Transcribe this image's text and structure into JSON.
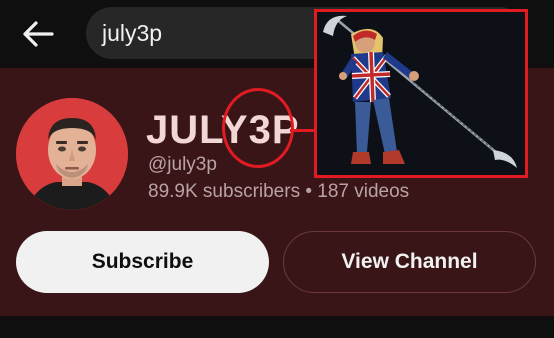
{
  "search": {
    "query": "july3p"
  },
  "channel": {
    "name": "JULY3P",
    "handle": "@july3p",
    "stats": "89.9K subscribers • 187 videos"
  },
  "actions": {
    "subscribe_label": "Subscribe",
    "view_channel_label": "View Channel"
  },
  "colors": {
    "panel_bg": "#3a1518",
    "annotation": "#e01b22",
    "subscribe_bg": "#f1f1f1"
  },
  "icons": {
    "back": "arrow-left-icon"
  }
}
